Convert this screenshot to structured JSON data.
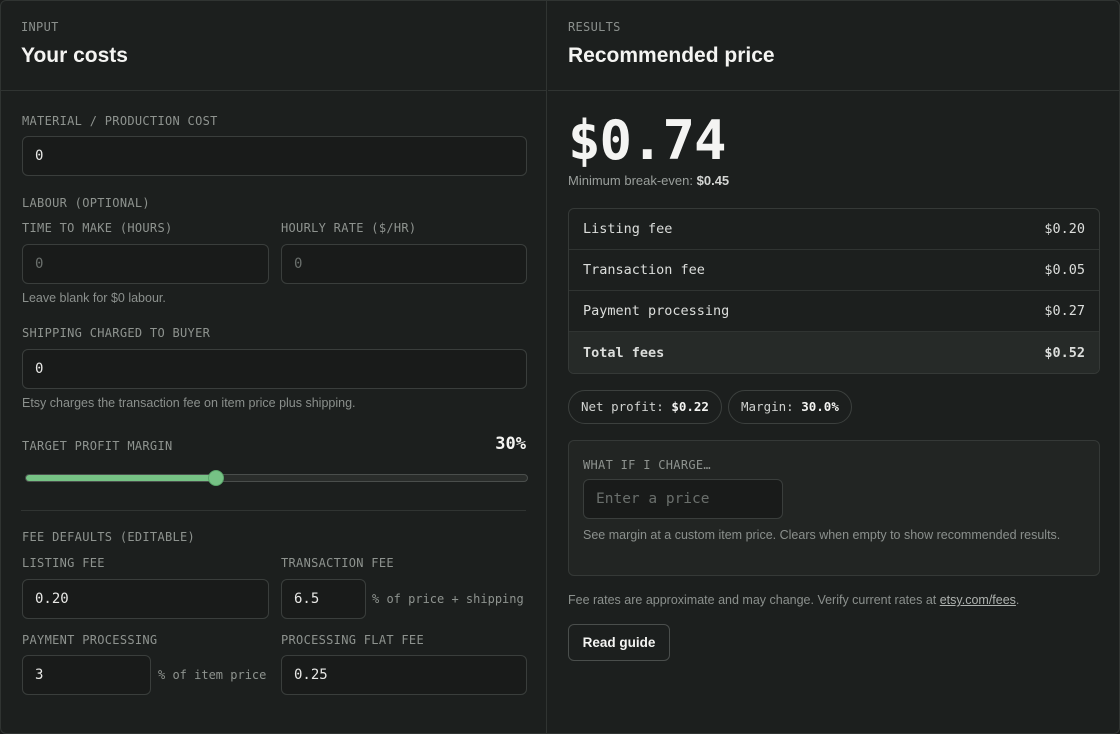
{
  "input": {
    "eyebrow": "INPUT",
    "title": "Your costs",
    "material_label": "MATERIAL / PRODUCTION COST",
    "material_value": "0",
    "labour_label": "LABOUR (OPTIONAL)",
    "time_label": "TIME TO MAKE (HOURS)",
    "time_placeholder": "0",
    "rate_label": "HOURLY RATE ($/HR)",
    "rate_placeholder": "0",
    "labour_hint": "Leave blank for $0 labour.",
    "shipping_label": "SHIPPING CHARGED TO BUYER",
    "shipping_value": "0",
    "shipping_hint": "Etsy charges the transaction fee on item price plus shipping.",
    "margin_label": "TARGET PROFIT MARGIN",
    "margin_display": "30%",
    "margin_fraction": 0.38,
    "fee_defaults_label": "FEE DEFAULTS (EDITABLE)",
    "listing_fee_label": "LISTING FEE",
    "listing_fee_value": "0.20",
    "transaction_fee_label": "TRANSACTION FEE",
    "transaction_fee_value": "6.5",
    "transaction_fee_unit": "% of price + shipping",
    "payment_label": "PAYMENT PROCESSING",
    "payment_value": "3",
    "payment_unit": "% of item price",
    "flat_fee_label": "PROCESSING FLAT FEE",
    "flat_fee_value": "0.25"
  },
  "results": {
    "eyebrow": "RESULTS",
    "title": "Recommended price",
    "price": "$0.74",
    "break_even_label": "Minimum break-even:",
    "break_even_value": "$0.45",
    "fees": [
      {
        "label": "Listing fee",
        "value": "$0.20"
      },
      {
        "label": "Transaction fee",
        "value": "$0.05"
      },
      {
        "label": "Payment processing",
        "value": "$0.27"
      }
    ],
    "total_label": "Total fees",
    "total_value": "$0.52",
    "net_profit_label": "Net profit:",
    "net_profit_value": "$0.22",
    "margin_label": "Margin:",
    "margin_value": "30.0%",
    "whatif_label": "WHAT IF I CHARGE…",
    "whatif_placeholder": "Enter a price",
    "whatif_hint": "See margin at a custom item price. Clears when empty to show recommended results.",
    "footer_text": "Fee rates are approximate and may change. Verify current rates at",
    "footer_link": "etsy.com/fees",
    "footer_end": ".",
    "guide_button": "Read guide"
  },
  "colors": {
    "accent": "#76c285",
    "background": "#1c1f1e",
    "border": "#303432"
  }
}
